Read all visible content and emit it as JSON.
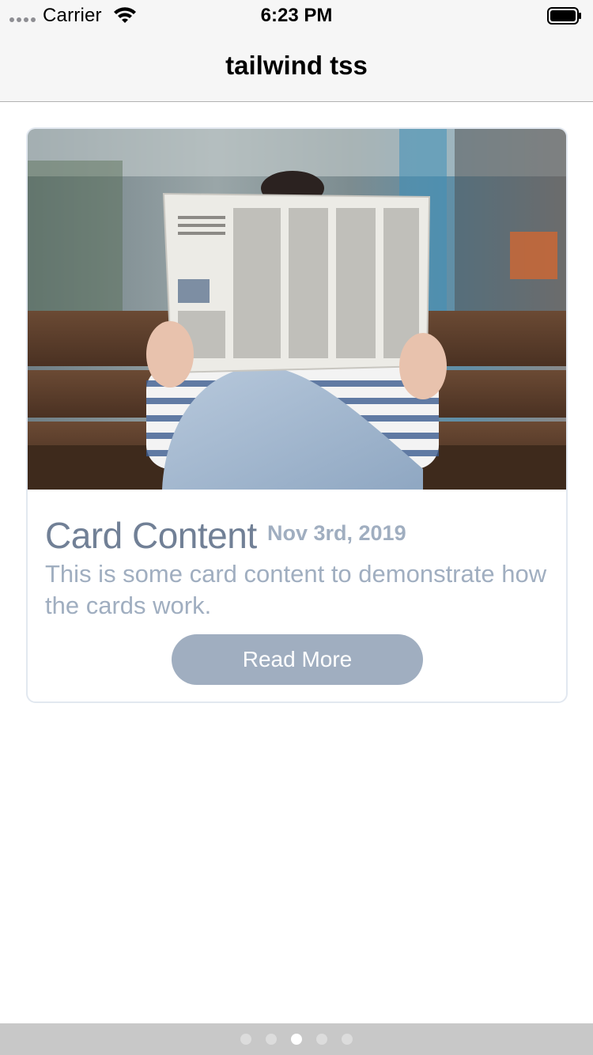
{
  "status_bar": {
    "carrier": "Carrier",
    "time": "6:23 PM"
  },
  "nav": {
    "title": "tailwind tss"
  },
  "card": {
    "title": "Card Content",
    "date": "Nov 3rd, 2019",
    "body": "This is some card content to demonstrate how the cards work.",
    "button_label": "Read More",
    "image_description_icon": "newspaper-photo"
  },
  "pager": {
    "pages": 5,
    "active_index": 2
  },
  "colors": {
    "title": "#718096",
    "muted": "#a0aec0",
    "border": "#e2e8f0",
    "bar": "#f6f6f6"
  }
}
